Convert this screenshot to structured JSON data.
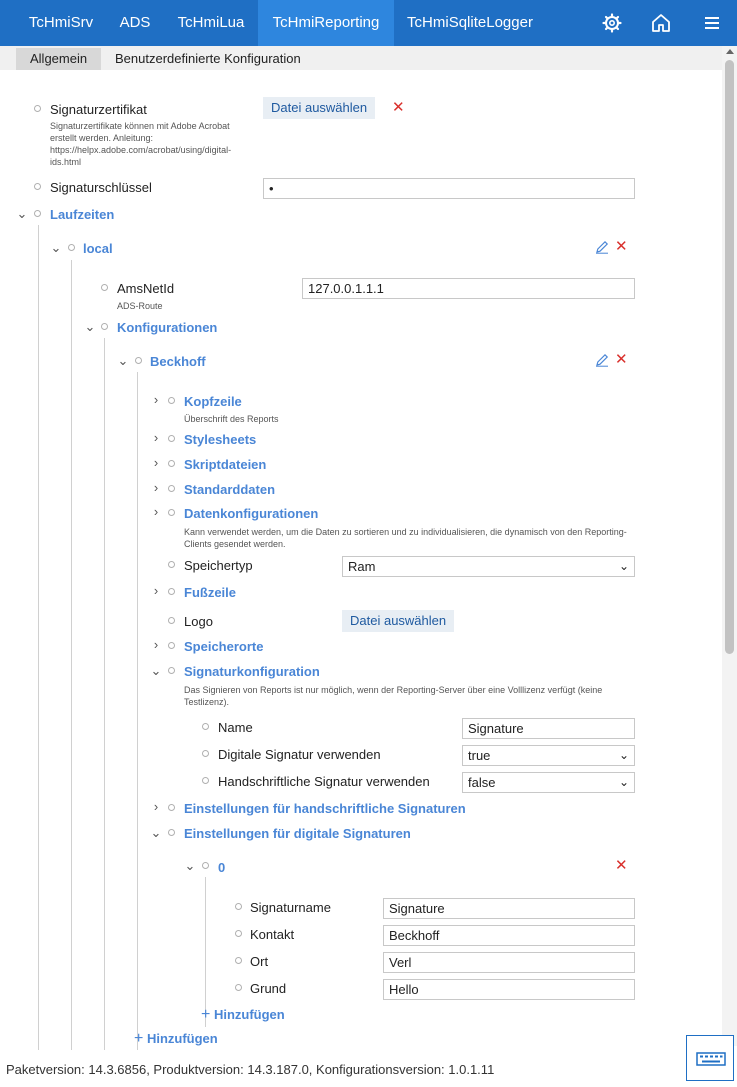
{
  "nav": {
    "tabs": [
      "TcHmiSrv",
      "ADS",
      "TcHmiLua",
      "TcHmiReporting",
      "TcHmiSqliteLogger"
    ],
    "active_tab": "TcHmiReporting",
    "icons": [
      "gear-icon",
      "home-icon",
      "menu-icon"
    ]
  },
  "subtabs": [
    "Allgemein",
    "Benutzerdefinierte Konfiguration"
  ],
  "colors": {
    "accent": "#1f6fc4",
    "active_tab": "#2e86de",
    "group": "#4a86d6",
    "delete": "#d9302c"
  },
  "form": {
    "sigcert_label": "Signaturzertifikat",
    "sigcert_desc": "Signaturzertifikate können mit Adobe Acrobat erstellt werden. Anleitung: https://helpx.adobe.com/acrobat/using/digital-ids.html",
    "sigcert_btn": "Datei auswählen",
    "sigkey_label": "Signaturschlüssel",
    "sigkey_value": "•",
    "runtimes_label": "Laufzeiten",
    "local_label": "local",
    "amsnetid_label": "AmsNetId",
    "amsnetid_desc": "ADS-Route",
    "amsnetid_value": "127.0.0.1.1.1",
    "configs_label": "Konfigurationen",
    "beckhoff_label": "Beckhoff",
    "header_label": "Kopfzeile",
    "header_desc": "Überschrift des Reports",
    "stylesheets_label": "Stylesheets",
    "scripts_label": "Skriptdateien",
    "standard_label": "Standarddaten",
    "dataconf_label": "Datenkonfigurationen",
    "dataconf_desc": "Kann verwendet werden, um die Daten zu sortieren und zu individualisieren, die dynamisch von den Reporting-Clients gesendet werden.",
    "memtype_label": "Speichertyp",
    "memtype_value": "Ram",
    "footer_label": "Fußzeile",
    "logo_label": "Logo",
    "logo_btn": "Datei auswählen",
    "storage_label": "Speicherorte",
    "sigconf_label": "Signaturkonfiguration",
    "sigconf_desc": "Das Signieren von Reports ist nur möglich, wenn der Reporting-Server über eine Volllizenz verfügt (keine Testlizenz).",
    "name_label": "Name",
    "name_value": "Signature",
    "digsig_label": "Digitale Signatur verwenden",
    "digsig_value": "true",
    "handsig_label": "Handschriftliche Signatur verwenden",
    "handsig_value": "false",
    "handsettings_label": "Einstellungen für handschriftliche Signaturen",
    "digsettings_label": "Einstellungen für digitale Signaturen",
    "entry0_label": "0",
    "signame_label": "Signaturname",
    "signame_value": "Signature",
    "contact_label": "Kontakt",
    "contact_value": "Beckhoff",
    "place_label": "Ort",
    "place_value": "Verl",
    "reason_label": "Grund",
    "reason_value": "Hello",
    "add_inner": "Hinzufügen",
    "add_outer": "Hinzufügen"
  },
  "footer": {
    "version_text": "Paketversion: 14.3.6856, Produktversion: 14.3.187.0, Konfigurationsversion: 1.0.1.11",
    "keyboard_icon": "keyboard-icon"
  }
}
